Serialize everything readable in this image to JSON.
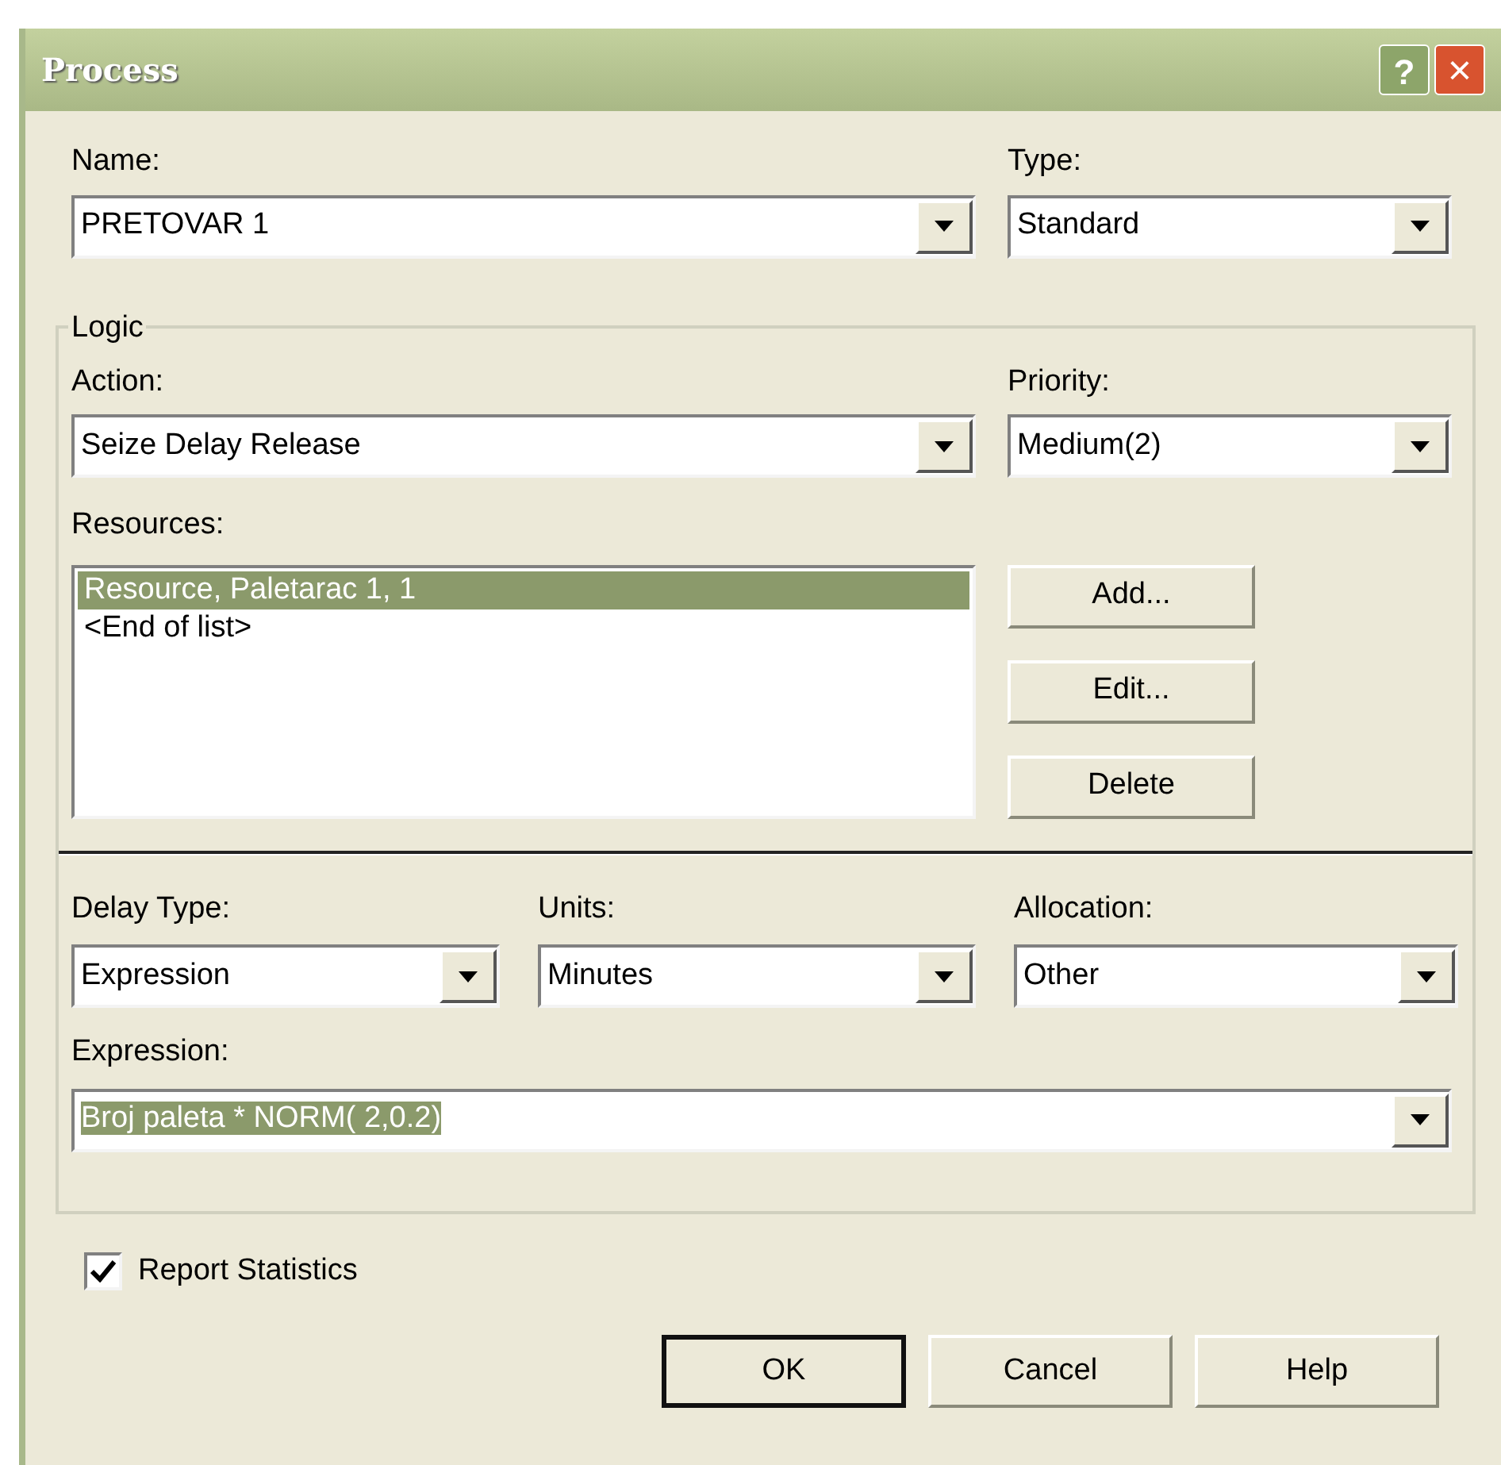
{
  "window": {
    "title": "Process",
    "help_button": "?",
    "close_button": "×"
  },
  "name_field": {
    "label": "Name:",
    "value": "PRETOVAR 1"
  },
  "type_field": {
    "label": "Type:",
    "value": "Standard"
  },
  "logic": {
    "title": "Logic",
    "action": {
      "label": "Action:",
      "value": "Seize Delay Release"
    },
    "priority": {
      "label": "Priority:",
      "value": "Medium(2)"
    },
    "resources": {
      "label": "Resources:",
      "items": [
        {
          "text": "Resource, Paletarac 1, 1",
          "selected": true
        },
        {
          "text": "<End of list>",
          "selected": false
        }
      ]
    },
    "resource_buttons": [
      "Add...",
      "Edit...",
      "Delete"
    ],
    "delay_type": {
      "label": "Delay Type:",
      "value": "Expression"
    },
    "units": {
      "label": "Units:",
      "value": "Minutes"
    },
    "allocation": {
      "label": "Allocation:",
      "value": "Other"
    },
    "expression": {
      "label": "Expression:",
      "value": "Broj paleta * NORM( 2,0.2)",
      "highlighted": true
    }
  },
  "report_statistics": {
    "label": "Report Statistics",
    "checked": true
  },
  "buttons": [
    {
      "label": "OK",
      "default": true
    },
    {
      "label": "Cancel",
      "default": false
    },
    {
      "label": "Help",
      "default": false
    }
  ]
}
